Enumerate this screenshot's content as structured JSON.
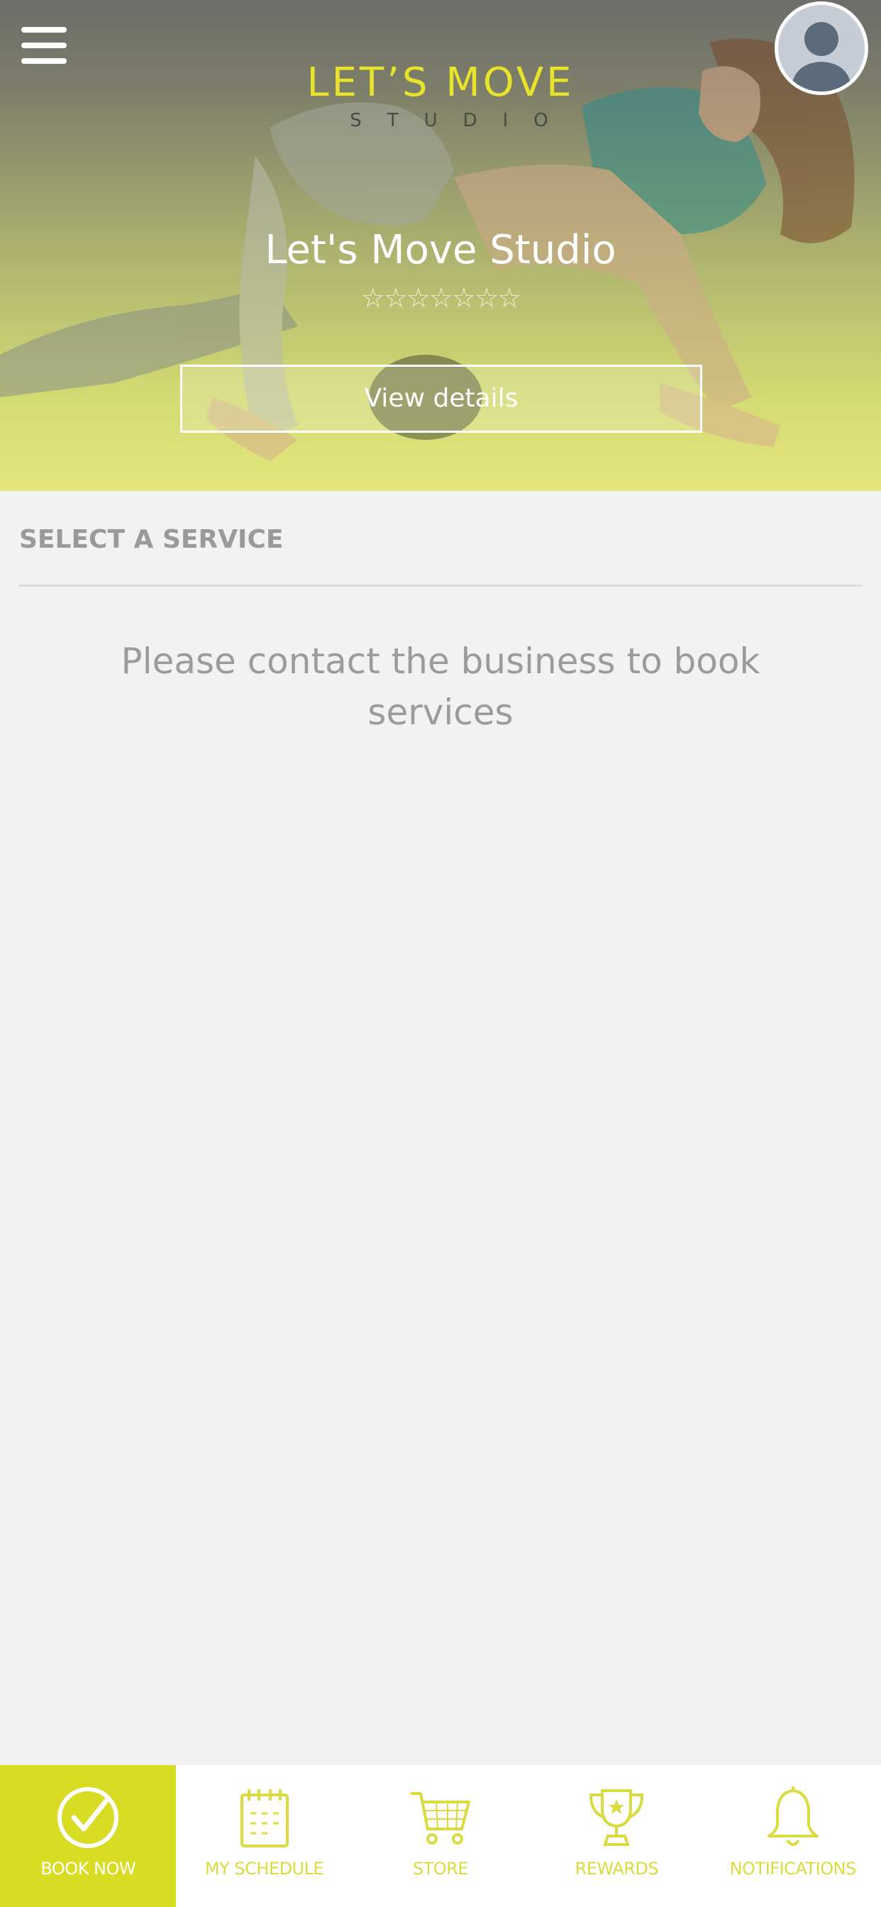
{
  "colors": {
    "accent": "#d8dc22",
    "accent_text": "#d9db3e",
    "background": "#f2f2f2"
  },
  "header": {
    "menu_icon": "hamburger-menu-icon",
    "avatar_icon": "user-avatar-icon",
    "logo_main": "LET’S MOVE",
    "logo_sub": "STUDIO",
    "studio_name": "Let's Move Studio",
    "rating_stars": "☆☆☆☆☆☆☆",
    "view_details_label": "View details"
  },
  "main": {
    "section_title": "SELECT A SERVICE",
    "empty_message": "Please contact the business to book services"
  },
  "tabbar": {
    "tabs": [
      {
        "label": "BOOK NOW",
        "icon": "check-circle-icon",
        "active": true
      },
      {
        "label": "MY SCHEDULE",
        "icon": "calendar-icon",
        "active": false
      },
      {
        "label": "STORE",
        "icon": "shopping-cart-icon",
        "active": false
      },
      {
        "label": "REWARDS",
        "icon": "trophy-icon",
        "active": false
      },
      {
        "label": "NOTIFICATIONS",
        "icon": "bell-icon",
        "active": false
      }
    ]
  }
}
